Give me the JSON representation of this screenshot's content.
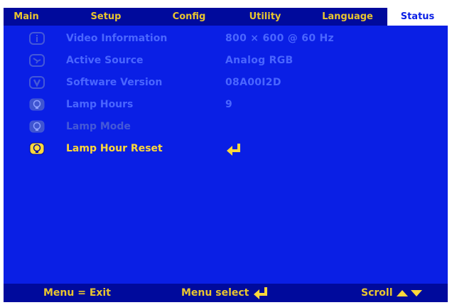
{
  "tabs": [
    {
      "label": "Main"
    },
    {
      "label": "Setup"
    },
    {
      "label": "Config"
    },
    {
      "label": "Utility"
    },
    {
      "label": "Language"
    },
    {
      "label": "Status",
      "active": true
    }
  ],
  "rows": [
    {
      "icon": "info-icon",
      "label": "Video Information",
      "value": "800  ×  600  @  60 Hz"
    },
    {
      "icon": "source-icon",
      "label": "Active Source",
      "value": "Analog RGB"
    },
    {
      "icon": "version-icon",
      "label": "Software Version",
      "value": "08A00I2D"
    },
    {
      "icon": "lamp-icon",
      "label": "Lamp Hours",
      "value": "9"
    },
    {
      "icon": "lamp-icon",
      "label": "Lamp Mode",
      "value": ""
    },
    {
      "icon": "lamp-reset-icon",
      "label": "Lamp Hour Reset",
      "value": "enter-arrow-icon",
      "selected": true
    }
  ],
  "footer": {
    "exit": "Menu = Exit",
    "select": "Menu select",
    "scroll": "Scroll"
  },
  "colors": {
    "background": "#0a1fe5",
    "bar": "#000a9c",
    "accent": "#e8c52f",
    "dim_text": "#4a66ff",
    "highlight": "#ffd83a"
  }
}
